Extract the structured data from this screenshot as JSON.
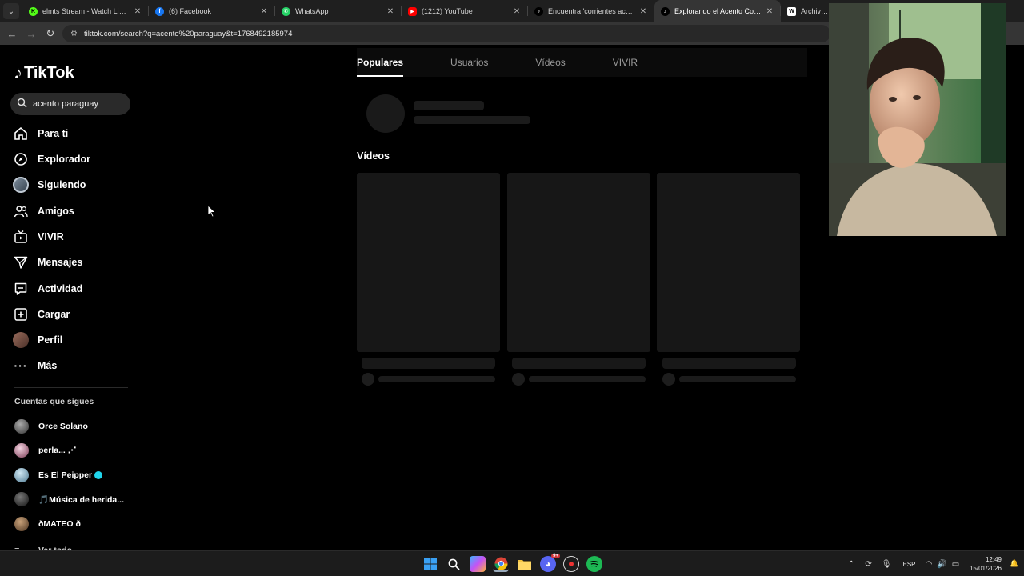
{
  "browser": {
    "tabs": [
      {
        "title": "elmts Stream - Watch Live on K",
        "color": "#53fc18",
        "glyph": "K"
      },
      {
        "title": "(6) Facebook",
        "color": "#1877f2",
        "glyph": "f"
      },
      {
        "title": "WhatsApp",
        "color": "#25d366",
        "glyph": "✆"
      },
      {
        "title": "(1212) YouTube",
        "color": "#ff0000",
        "glyph": "▶"
      },
      {
        "title": "Encuentra 'corrientes acentop",
        "color": "#111111",
        "glyph": "♪"
      },
      {
        "title": "Explorando el Acento Correntin",
        "color": "#111111",
        "glyph": "♪"
      },
      {
        "title": "ArchivosMa",
        "color": "#ffffff",
        "glyph": "W"
      }
    ],
    "url": "tiktok.com/search?q=acento%20paraguay&t=1768492185974"
  },
  "tiktok": {
    "brand": "TikTok",
    "search_value": "acento paraguay",
    "nav": [
      {
        "label": "Para ti",
        "icon": "home-icon"
      },
      {
        "label": "Explorador",
        "icon": "compass-icon"
      },
      {
        "label": "Siguiendo",
        "icon": "following-avatar-icon"
      },
      {
        "label": "Amigos",
        "icon": "friends-icon"
      },
      {
        "label": "VIVIR",
        "icon": "live-icon"
      },
      {
        "label": "Mensajes",
        "icon": "send-icon"
      },
      {
        "label": "Actividad",
        "icon": "activity-icon"
      },
      {
        "label": "Cargar",
        "icon": "upload-icon"
      },
      {
        "label": "Perfil",
        "icon": "profile-avatar-icon"
      },
      {
        "label": "Más",
        "icon": "more-icon"
      }
    ],
    "following_title": "Cuentas que sigues",
    "following": [
      {
        "name": "Orce Solano",
        "verified": false
      },
      {
        "name": "perla...  ⋰",
        "verified": false
      },
      {
        "name": "Es El Peipper",
        "verified": true
      },
      {
        "name": "🎵Música de herida...",
        "verified": false
      },
      {
        "name": "ðMATEO ð",
        "verified": false
      }
    ],
    "see_all": "Ver todo",
    "tabs": [
      "Populares",
      "Usuarios",
      "Vídeos",
      "VIVIR"
    ],
    "active_tab": "Populares",
    "videos_heading": "Vídeos"
  },
  "taskbar": {
    "language": "ESP",
    "time": "12:49",
    "date": "15/01/2026",
    "apps": [
      "windows-start-icon",
      "search-icon",
      "copilot-icon",
      "chrome-icon",
      "file-explorer-icon",
      "discord-icon",
      "game-launcher-icon",
      "spotify-icon"
    ],
    "discord_badge": "9+"
  }
}
